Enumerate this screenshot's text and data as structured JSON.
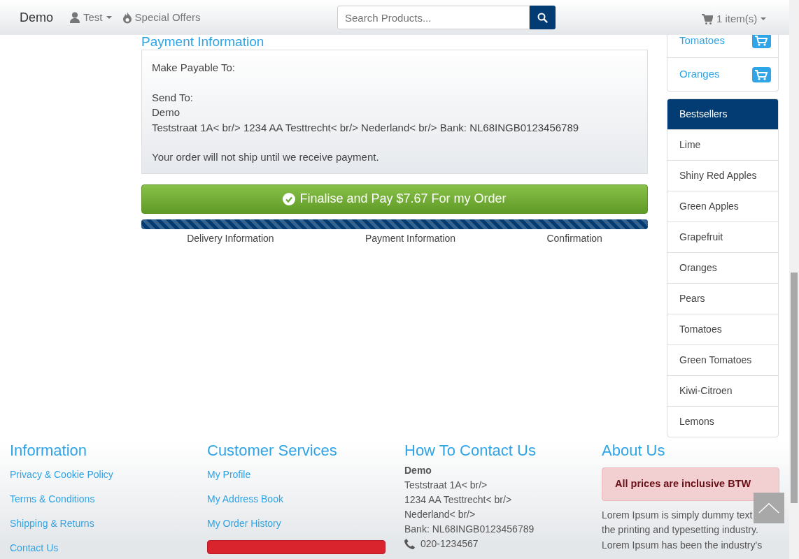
{
  "navbar": {
    "brand": "Demo",
    "user_menu": "Test",
    "offers": "Special Offers",
    "search": {
      "placeholder": "Search Products..."
    },
    "cart": "1 item(s)"
  },
  "payment": {
    "title": "Payment Information",
    "blocks": [
      {
        "lines": [
          "Make Payable To:"
        ]
      },
      {
        "lines": [
          "Send To:",
          "Demo",
          "Teststraat 1A< br/> 1234 AA Testtrecht< br/> Nederland< br/> Bank: NL68INGB0123456789"
        ]
      },
      {
        "lines": [
          "Your order will not ship until we receive payment."
        ]
      }
    ],
    "button": "Finalise and Pay $7.67 For my Order",
    "progress": {
      "level": 1,
      "steps": [
        "Delivery Information",
        "Payment Information",
        "Confirmation"
      ]
    }
  },
  "sidebar": {
    "products": [
      {
        "name": "Tomatoes"
      },
      {
        "name": "Oranges"
      }
    ],
    "bestsellers": {
      "title": "Bestsellers",
      "items": [
        "Lime",
        "Shiny Red Apples",
        "Green Apples",
        "Grapefruit",
        "Oranges",
        "Pears",
        "Tomatoes",
        "Green Tomatoes",
        "Kiwi-Citroen",
        "Lemons"
      ]
    }
  },
  "footer": {
    "information": {
      "title": "Information",
      "links": [
        "Privacy & Cookie Policy",
        "Terms & Conditions",
        "Shipping & Returns",
        "Contact Us"
      ]
    },
    "services": {
      "title": "Customer Services",
      "links": [
        "My Profile",
        "My Address Book",
        "My Order History"
      ]
    },
    "contact": {
      "title": "How To Contact Us",
      "name": "Demo",
      "lines": [
        "Teststraat 1A< br/>",
        "1234 AA Testtrecht< br/>",
        "Nederland< br/>",
        "Bank: NL68INGB0123456789"
      ],
      "phone": "020-1234567"
    },
    "about": {
      "title": "About Us",
      "alert": "All prices are inclusive BTW",
      "lines": [
        "Lorem Ipsum is simply dummy text",
        "the printing and typesetting industry.",
        "Lorem Ipsum has been the industry's"
      ]
    }
  }
}
